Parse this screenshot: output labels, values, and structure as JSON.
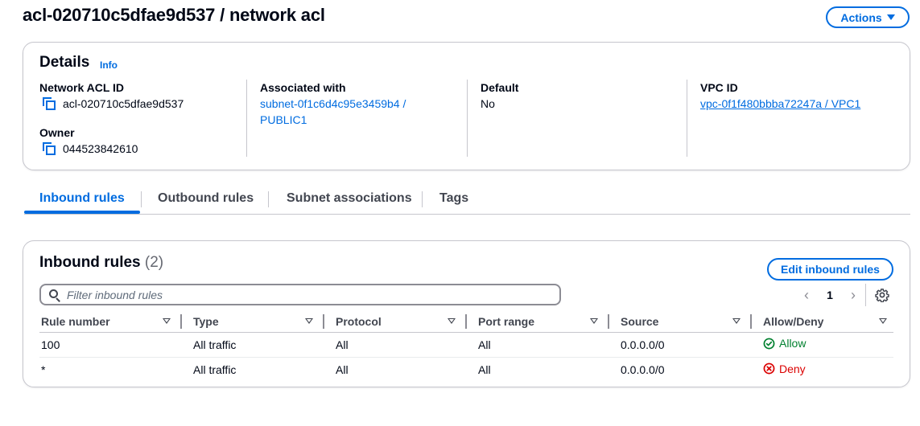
{
  "header": {
    "title": "acl-020710c5dfae9d537 / network acl",
    "actions_label": "Actions"
  },
  "details": {
    "title": "Details",
    "info_label": "Info",
    "network_acl_id_label": "Network ACL ID",
    "network_acl_id": "acl-020710c5dfae9d537",
    "owner_label": "Owner",
    "owner": "044523842610",
    "associated_with_label": "Associated with",
    "associated_with_line1": "subnet-0f1c6d4c95e3459b4 /",
    "associated_with_line2": "PUBLIC1",
    "default_label": "Default",
    "default_value": "No",
    "vpc_id_label": "VPC ID",
    "vpc_id": "vpc-0f1f480bbba72247a / VPC1"
  },
  "tabs": [
    {
      "label": "Inbound rules",
      "active": true
    },
    {
      "label": "Outbound rules",
      "active": false
    },
    {
      "label": "Subnet associations",
      "active": false
    },
    {
      "label": "Tags",
      "active": false
    }
  ],
  "inbound_rules": {
    "title": "Inbound rules",
    "count": "(2)",
    "edit_label": "Edit inbound rules",
    "filter_placeholder": "Filter inbound rules",
    "page": "1",
    "columns": [
      "Rule number",
      "Type",
      "Protocol",
      "Port range",
      "Source",
      "Allow/Deny"
    ],
    "rows": [
      {
        "rule_number": "100",
        "type": "All traffic",
        "protocol": "All",
        "port_range": "All",
        "source": "0.0.0.0/0",
        "action": "Allow"
      },
      {
        "rule_number": "*",
        "type": "All traffic",
        "protocol": "All",
        "port_range": "All",
        "source": "0.0.0.0/0",
        "action": "Deny"
      }
    ]
  },
  "colors": {
    "accent": "#006ce0",
    "allow": "#00802f",
    "deny": "#db0000",
    "border": "#c6c6cd"
  },
  "icons": [
    "copy-icon",
    "search-icon",
    "chevron-left-icon",
    "chevron-right-icon",
    "gear-icon",
    "check-circle-icon",
    "x-circle-icon",
    "caret-down-icon"
  ]
}
